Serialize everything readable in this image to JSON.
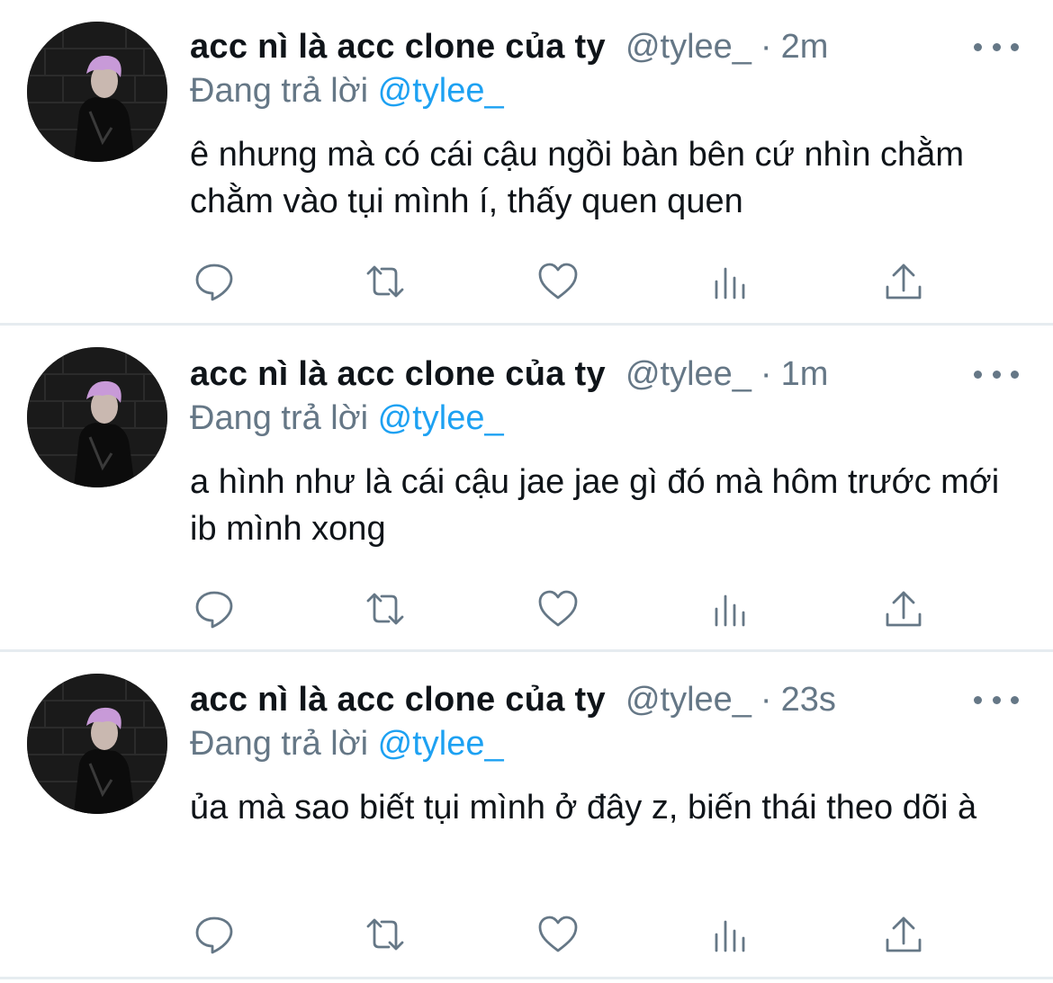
{
  "colors": {
    "text": "#0f1419",
    "secondary": "#657786",
    "link": "#1da1f2",
    "divider": "#e6ecf0"
  },
  "tweets": [
    {
      "display_name": "acc nì là acc clone của ty",
      "handle": "@tylee_",
      "separator": "·",
      "time": "2m",
      "reply_prefix": "Đang trả lời",
      "reply_handle": "@tylee_",
      "text": "ê nhưng mà có cái cậu ngồi bàn bên cứ nhìn chằm chằm vào tụi mình í, thấy quen quen",
      "actions": [
        "reply-icon",
        "retweet-icon",
        "like-icon",
        "analytics-icon",
        "share-icon"
      ]
    },
    {
      "display_name": "acc nì là acc clone của ty",
      "handle": "@tylee_",
      "separator": "·",
      "time": "1m",
      "reply_prefix": "Đang trả lời",
      "reply_handle": "@tylee_",
      "text": "a hình như là cái cậu jae jae gì đó mà hôm trước mới ib mình xong",
      "actions": [
        "reply-icon",
        "retweet-icon",
        "like-icon",
        "analytics-icon",
        "share-icon"
      ]
    },
    {
      "display_name": "acc nì là acc clone của ty",
      "handle": "@tylee_",
      "separator": "·",
      "time": "23s",
      "reply_prefix": "Đang trả lời",
      "reply_handle": "@tylee_",
      "text": "ủa mà sao biết tụi mình ở đây z, biến thái theo dõi à",
      "actions": [
        "reply-icon",
        "retweet-icon",
        "like-icon",
        "analytics-icon",
        "share-icon"
      ]
    }
  ]
}
